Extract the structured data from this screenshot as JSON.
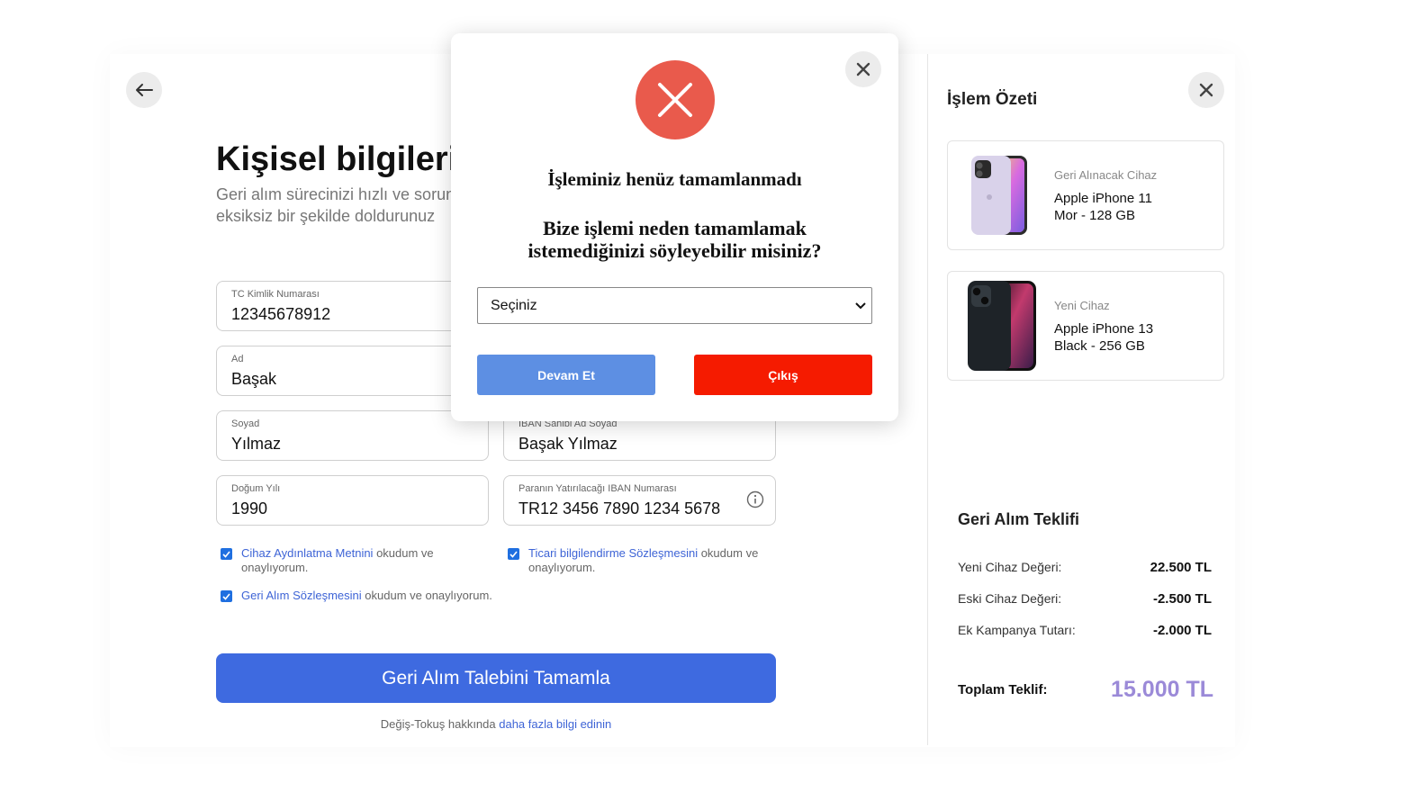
{
  "page": {
    "title": "Kişisel bilgileri",
    "subtitle_line1": "Geri alım sürecinizi hızlı ve sorunsuz",
    "subtitle_line2": "eksiksiz bir şekilde doldurunuz"
  },
  "form": {
    "tc": {
      "label": "TC Kimlik Numarası",
      "value": "12345678912"
    },
    "ad": {
      "label": "Ad",
      "value": "Başak"
    },
    "soyad": {
      "label": "Soyad",
      "value": "Yılmaz"
    },
    "dogum": {
      "label": "Doğum Yılı",
      "value": "1990"
    },
    "iban_sahibi": {
      "label": "IBAN Sahibi Ad Soyad",
      "value": "Başak Yılmaz"
    },
    "iban": {
      "label": "Paranın Yatırılacağı IBAN Numarası",
      "value": "TR12 3456 7890 1234 5678"
    }
  },
  "checks": {
    "c1_link": "Cihaz Aydınlatma Metnini",
    "c1_rest": " okudum ve onaylıyorum.",
    "c2_link": "Ticari bilgilendirme Sözleşmesini",
    "c2_rest": " okudum ve onaylıyorum.",
    "c3_link": "Geri Alım Sözleşmesini",
    "c3_rest": " okudum ve onaylıyorum."
  },
  "submit_label": "Geri Alım Talebini Tamamla",
  "more": {
    "text": "Değiş-Tokuş hakkında ",
    "link": "daha fazla bilgi edinin"
  },
  "summary": {
    "title": "İşlem Özeti",
    "old_device": {
      "kind": "Geri Alınacak Cihaz",
      "name1": "Apple iPhone 11",
      "name2": "Mor - 128 GB"
    },
    "new_device": {
      "kind": "Yeni Cihaz",
      "name1": "Apple iPhone 13",
      "name2": "Black - 256 GB"
    },
    "offer_title": "Geri Alım Teklifi",
    "rows": [
      {
        "k": "Yeni Cihaz Değeri:",
        "v": "22.500 TL"
      },
      {
        "k": "Eski Cihaz Değeri:",
        "v": "-2.500 TL"
      },
      {
        "k": "Ek Kampanya Tutarı:",
        "v": "-2.000 TL"
      }
    ],
    "total_label": "Toplam Teklif:",
    "total_value": "15.000 TL"
  },
  "modal": {
    "heading": "İşleminiz henüz tamamlanmadı",
    "question": "Bize işlemi neden tamamlamak istemediğinizi söyleyebilir misiniz?",
    "select_value": "Seçiniz",
    "continue_label": "Devam Et",
    "exit_label": "Çıkış"
  },
  "colors": {
    "primary": "#3e6ae0",
    "error": "#e95a4c",
    "exit": "#f51b00",
    "total": "#9b8ad8"
  }
}
